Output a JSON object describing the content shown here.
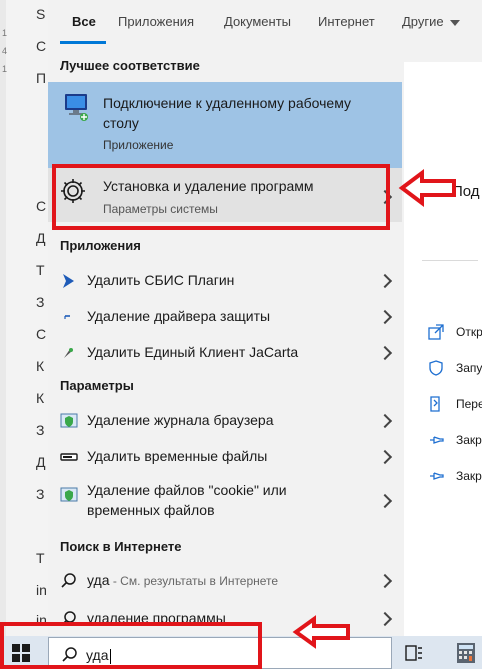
{
  "background_doc": {
    "letters": [
      "S",
      "С",
      "П",
      "С",
      "З",
      "Д",
      "Т",
      "З",
      "К",
      "К",
      "З",
      "Д",
      "З",
      "Т",
      "in",
      "in"
    ]
  },
  "tabs": [
    {
      "label": "Все",
      "active": true
    },
    {
      "label": "Приложения",
      "active": false
    },
    {
      "label": "Документы",
      "active": false
    },
    {
      "label": "Интернет",
      "active": false
    },
    {
      "label": "Другие",
      "active": false
    }
  ],
  "best_match": {
    "heading": "Лучшее соответствие",
    "title": "Подключение к удаленному рабочему столу",
    "subtitle": "Приложение"
  },
  "highlighted_item": {
    "title": "Установка и удаление программ",
    "subtitle": "Параметры системы"
  },
  "apps": {
    "heading": "Приложения",
    "items": [
      {
        "label": "Удалить СБИС Плагин"
      },
      {
        "label": "Удаление драйвера защиты"
      },
      {
        "label": "Удалить Единый Клиент JaCarta"
      }
    ]
  },
  "settings": {
    "heading": "Параметры",
    "items": [
      {
        "label": "Удаление журнала браузера"
      },
      {
        "label": "Удалить временные файлы"
      },
      {
        "label": "Удаление файлов \"cookie\" или временных файлов"
      }
    ]
  },
  "web": {
    "heading": "Поиск в Интернете",
    "items": [
      {
        "label": "уда",
        "hint": " - См. результаты в Интернете"
      },
      {
        "label": "удаление программы"
      }
    ]
  },
  "preview": {
    "title": "Под",
    "actions": [
      {
        "label": "Откр"
      },
      {
        "label": "Запу"
      },
      {
        "label": "Пере"
      },
      {
        "label": "Закр"
      },
      {
        "label": "Закр"
      }
    ]
  },
  "search": {
    "query": "уда"
  },
  "colors": {
    "accent": "#0078d7",
    "annotation": "#e1151a",
    "best_bg": "#9ec3e5"
  }
}
